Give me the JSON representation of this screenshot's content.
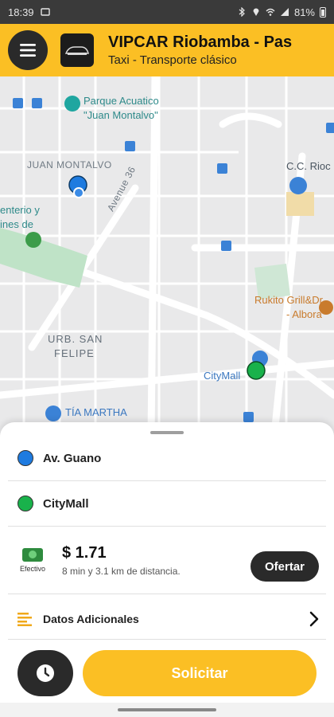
{
  "status_bar": {
    "time": "18:39",
    "battery": "81%"
  },
  "header": {
    "title": "VIPCAR Riobamba - Pas",
    "subtitle": "Taxi - Transporte clásico",
    "menu_icon": "hamburger-icon",
    "logo_icon": "vipcar-logo"
  },
  "map": {
    "labels": {
      "park": "Parque Acuatico",
      "park2": "\"Juan Montalvo\"",
      "juan_montalvo": "JUAN MONTALVO",
      "avenue": "Avenue 36",
      "cc": "C.C. Rioc",
      "cemetery1": "enterio y",
      "cemetery2": "ines de",
      "rukito1": "Rukito Grill&Dr",
      "rukito2": "- Albora",
      "urb1": "URB. SAN",
      "urb2": "FELIPE",
      "citymall": "CityMall",
      "tia": "TÍA MARTHA"
    },
    "colors": {
      "origin": "#1e7be0",
      "destination": "#19b24b"
    }
  },
  "sheet": {
    "origin": {
      "label": "Av. Guano",
      "color": "#1e7be0"
    },
    "destination": {
      "label": "CityMall",
      "color": "#19b24b"
    },
    "payment": {
      "label": "Efectivo",
      "icon": "cash-icon"
    },
    "price": "$ 1.71",
    "trip_info": "8 min y 3.1 km de distancia.",
    "offer_label": "Ofertar",
    "extra_label": "Datos Adicionales",
    "extra_icon": "list-icon",
    "request_label": "Solicitar",
    "clock_icon": "clock-icon",
    "accent": "#fbbf24"
  }
}
